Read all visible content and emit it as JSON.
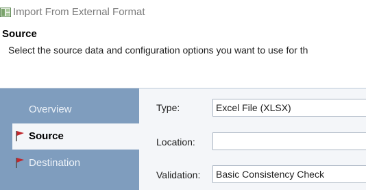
{
  "window": {
    "title": "Import From External Format",
    "icon": "import-icon"
  },
  "header": {
    "title": "Source",
    "description": "Select the source data and configuration options you want to use for th"
  },
  "nav": {
    "items": [
      {
        "label": "Overview",
        "icon": null,
        "selected": false
      },
      {
        "label": "Source",
        "icon": "red-flag-icon",
        "selected": true
      },
      {
        "label": "Destination",
        "icon": "red-flag-icon",
        "selected": false
      }
    ]
  },
  "form": {
    "type": {
      "label": "Type:",
      "value": "Excel File (XLSX)"
    },
    "location": {
      "label": "Location:",
      "value": ""
    },
    "validation": {
      "label": "Validation:",
      "value": "Basic Consistency Check"
    }
  },
  "colors": {
    "nav_background": "#7f9dbe",
    "form_background": "#f4f6f9",
    "flag": "#c0282d"
  }
}
